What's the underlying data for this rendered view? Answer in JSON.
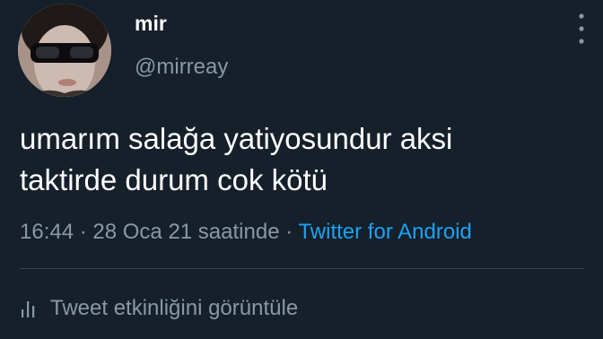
{
  "tweet": {
    "author": {
      "display_name": "mir",
      "handle": "@mirreay"
    },
    "text_lines": [
      "umarım salağa yatiyosundur aksi",
      "taktirde durum cok kötü"
    ],
    "meta": {
      "time": "16:44",
      "separator": " · ",
      "date": "28 Oca 21 saatinde",
      "source": "Twitter for Android"
    },
    "activity_label": "Tweet etkinliğini görüntüle"
  },
  "icons": {
    "more": "more-vertical-icon",
    "activity": "bar-chart-icon"
  },
  "colors": {
    "background": "#15202b",
    "primary_text": "#ffffff",
    "secondary_text": "#8899a6",
    "link": "#1da1f2",
    "divider": "#38444d"
  }
}
